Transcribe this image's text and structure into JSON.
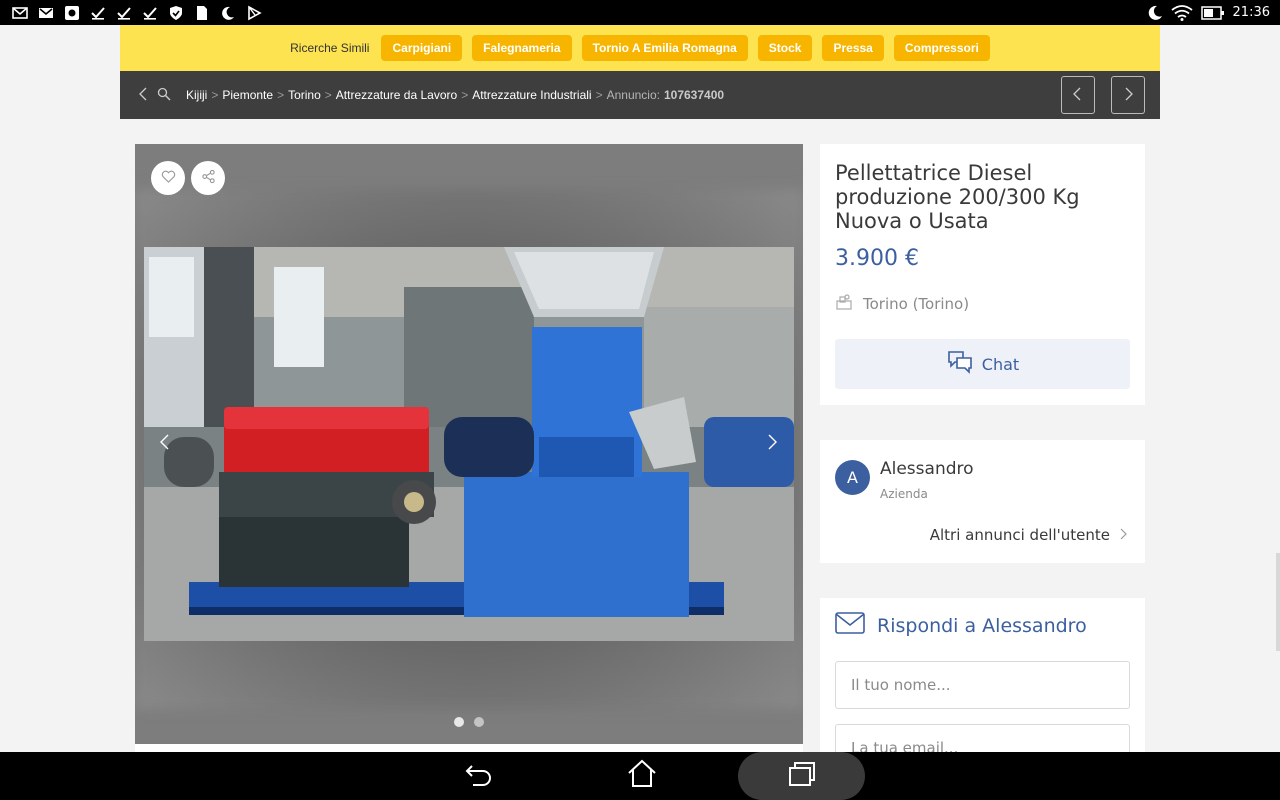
{
  "status_bar": {
    "time": "21:36",
    "icons": [
      "mail-icon",
      "gmail-icon",
      "photo-icon",
      "check-icon",
      "check-icon",
      "check-icon",
      "shield-icon",
      "file-icon",
      "moon-icon",
      "play-store-icon"
    ],
    "right_icons": [
      "do-not-disturb-icon",
      "wifi-icon",
      "battery-icon"
    ]
  },
  "similar_searches": {
    "label": "Ricerche Simili",
    "chips": [
      "Carpigiani",
      "Falegnameria",
      "Tornio A Emilia Romagna",
      "Stock",
      "Pressa",
      "Compressori"
    ]
  },
  "breadcrumb": {
    "items": [
      "Kijiji",
      "Piemonte",
      "Torino",
      "Attrezzature da Lavoro",
      "Attrezzature Industriali"
    ],
    "ad_label": "Annuncio:",
    "ad_number": "107637400"
  },
  "gallery": {
    "favorite_icon": "heart-icon",
    "share_icon": "share-icon",
    "image_count": 2,
    "current_image": 1
  },
  "ad": {
    "title": "Pellettatrice Diesel produzione 200/300 Kg Nuova o Usata",
    "price": "3.900 €",
    "location": "Torino (Torino)",
    "chat_label": "Chat"
  },
  "seller": {
    "initial": "A",
    "name": "Alessandro",
    "type": "Azienda",
    "other_ads": "Altri annunci dell'utente"
  },
  "reply": {
    "title": "Rispondi a Alessandro",
    "name_placeholder": "Il tuo nome...",
    "email_placeholder": "La tua email..."
  },
  "colors": {
    "yellow_bar": "#fde350",
    "chip": "#f7b500",
    "dark_bar": "#3e3e3e",
    "accent_blue": "#3c5fa0"
  }
}
